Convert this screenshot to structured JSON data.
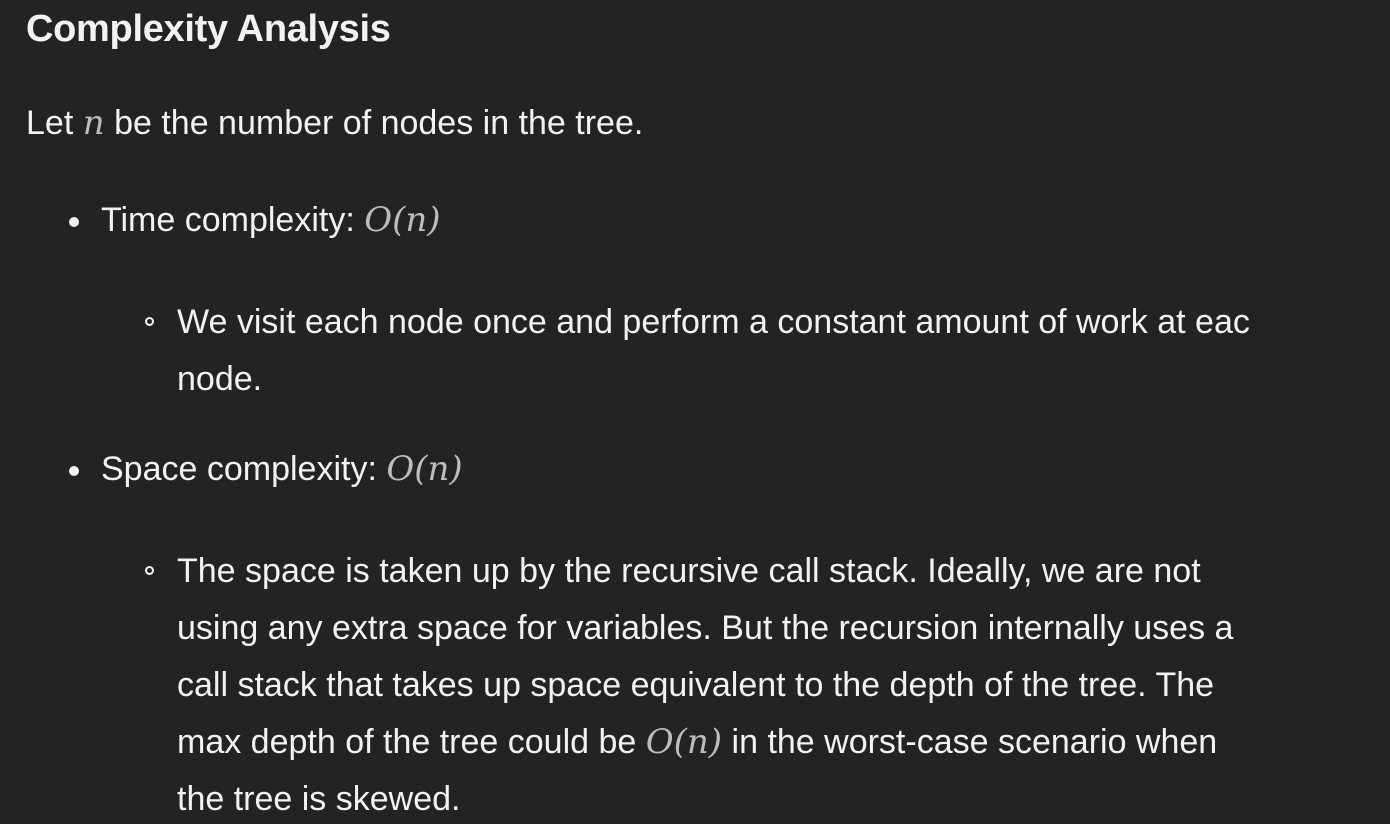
{
  "heading": "Complexity Analysis",
  "intro": {
    "before": "Let",
    "var": "n",
    "after": "be the number of nodes in the tree."
  },
  "time": {
    "label": "Time complexity:",
    "value": "O(n)",
    "detail": {
      "line1": "We visit each node once and perform a constant amount of work at eac",
      "line2": "node."
    }
  },
  "space": {
    "label": "Space complexity:",
    "value": "O(n)",
    "detail": {
      "line1": "The space is taken up by the recursive call stack. Ideally, we are not",
      "line2": "using any extra space for variables. But the recursion internally uses a",
      "line3": "call stack that takes up space equivalent to the depth of the tree. The",
      "line4_before": "max depth of the tree could be",
      "line4_math": "O(n)",
      "line4_after": "in the worst-case scenario when",
      "line5": "the tree is skewed."
    }
  }
}
